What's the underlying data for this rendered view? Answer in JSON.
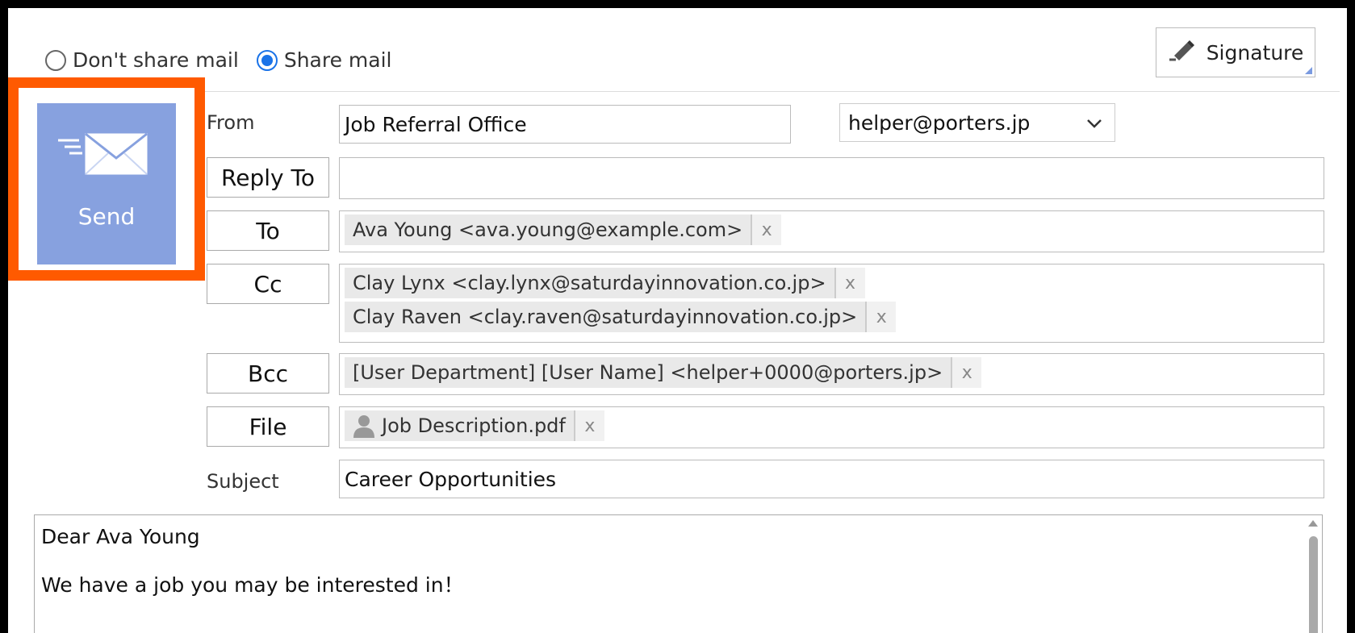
{
  "share": {
    "options": [
      {
        "label": "Don't share mail",
        "checked": false
      },
      {
        "label": "Share mail",
        "checked": true
      }
    ]
  },
  "toolbar": {
    "signature_label": "Signature",
    "send_label": "Send"
  },
  "from": {
    "label": "From",
    "name_value": "Job Referral Office",
    "address_value": "helper@porters.jp"
  },
  "reply_to": {
    "label": "Reply To",
    "value": ""
  },
  "to": {
    "label": "To",
    "recipients": [
      "Ava Young <ava.young@example.com>"
    ]
  },
  "cc": {
    "label": "Cc",
    "recipients": [
      "Clay Lynx <clay.lynx@saturdayinnovation.co.jp>",
      "Clay Raven <clay.raven@saturdayinnovation.co.jp>"
    ]
  },
  "bcc": {
    "label": "Bcc",
    "recipients": [
      "[User Department] [User Name] <helper+0000@porters.jp>"
    ]
  },
  "file": {
    "label": "File",
    "attachments": [
      "Job Description.pdf"
    ]
  },
  "subject": {
    "label": "Subject",
    "value": "Career Opportunities"
  },
  "body": {
    "lines": [
      "Dear Ava Young",
      "We have a job you may be interested in！"
    ]
  },
  "chip_remove_glyph": "x",
  "colors": {
    "accent": "#1a73e8",
    "send_bg": "#87a1df",
    "highlight": "#ff5a00"
  }
}
